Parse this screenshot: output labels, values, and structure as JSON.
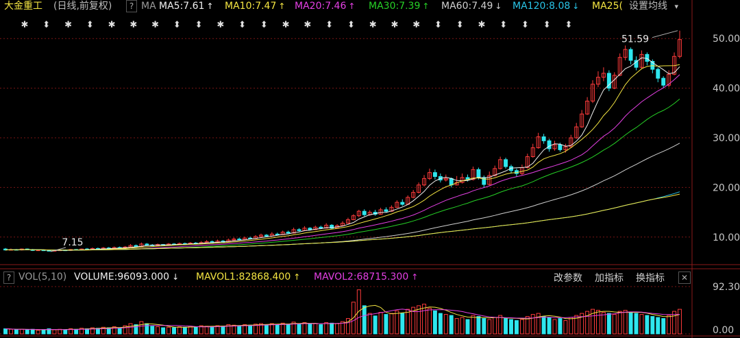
{
  "header": {
    "stock_name": "大金重工",
    "period_label": "(日线,前复权)",
    "help_label": "?",
    "ma_prefix": "MA",
    "ma_items": [
      {
        "label": "MA5:7.61",
        "arrow": "↑",
        "color": "#f0f0f0"
      },
      {
        "label": "MA10:7.47",
        "arrow": "↑",
        "color": "#f5e642"
      },
      {
        "label": "MA20:7.46",
        "arrow": "↑",
        "color": "#e540e5"
      },
      {
        "label": "MA30:7.39",
        "arrow": "↑",
        "color": "#26d126"
      },
      {
        "label": "MA60:7.49",
        "arrow": "↓",
        "color": "#d0d0d0"
      },
      {
        "label": "MA120:8.08",
        "arrow": "↓",
        "color": "#29c5e8"
      },
      {
        "label": "MA25(",
        "arrow": "",
        "color": "#f5e642"
      }
    ],
    "settings_label": "设置均线",
    "settings_arrow": "▾"
  },
  "volume_header": {
    "help_label": "?",
    "indicator_label": "VOL(5,10)",
    "items": [
      {
        "label": "VOLUME:96093.000",
        "arrow": "↓",
        "color": "#f0f0f0"
      },
      {
        "label": "MAVOL1:82868.400",
        "arrow": "↑",
        "color": "#f5e642"
      },
      {
        "label": "MAVOL2:68715.300",
        "arrow": "↑",
        "color": "#e540e5"
      }
    ],
    "buttons": {
      "modify_params": "改参数",
      "add_indicator": "加指标",
      "switch_indicator": "换指标",
      "close": "✕"
    }
  },
  "chart_data": {
    "type": "candlestick",
    "price_axis": {
      "ticks": [
        "50.00",
        "40.00",
        "30.00",
        "20.00",
        "10.00"
      ],
      "range": [
        5,
        55
      ]
    },
    "volume_axis": {
      "ticks": [
        "92.30",
        "0.00"
      ],
      "range": [
        0,
        92.3
      ]
    },
    "annotations": {
      "high_label": "51.59",
      "low_label": "7.15"
    },
    "marker_row": [
      "✱",
      "⬍",
      "✱",
      "⬍",
      "✱",
      "✱",
      "✱",
      "⬍",
      "⬍",
      "✱",
      "⬍",
      "⬍",
      "✱",
      "✱",
      "⬍",
      "⬍",
      "✱",
      "✱",
      "✱",
      "⬍",
      "⬍",
      "✱",
      "⬍",
      "⬍",
      "⬍",
      "⬍"
    ],
    "colors": {
      "up": "#ff3b3b",
      "down": "#2ee6ee",
      "ma5": "#f0f0f0",
      "ma10": "#f5e642",
      "ma20": "#e540e5",
      "ma30": "#26d126",
      "ma60": "#d0d0d0",
      "ma120": "#29c5e8",
      "ma250": "#f5e642"
    },
    "candles": [
      [
        7.6,
        7.4,
        7.8,
        7.3,
        10
      ],
      [
        7.4,
        7.5,
        7.7,
        7.3,
        9
      ],
      [
        7.5,
        7.4,
        7.6,
        7.3,
        8
      ],
      [
        7.4,
        7.6,
        7.7,
        7.3,
        9
      ],
      [
        7.6,
        7.5,
        7.7,
        7.4,
        8
      ],
      [
        7.5,
        7.3,
        7.6,
        7.2,
        9
      ],
      [
        7.3,
        7.4,
        7.5,
        7.2,
        7
      ],
      [
        7.4,
        7.3,
        7.5,
        7.2,
        8
      ],
      [
        7.3,
        7.2,
        7.4,
        7.15,
        10
      ],
      [
        7.2,
        7.3,
        7.4,
        7.1,
        8
      ],
      [
        7.3,
        7.4,
        7.5,
        7.2,
        9
      ],
      [
        7.4,
        7.3,
        7.5,
        7.2,
        8
      ],
      [
        7.3,
        7.5,
        7.6,
        7.2,
        10
      ],
      [
        7.5,
        7.4,
        7.6,
        7.3,
        9
      ],
      [
        7.4,
        7.6,
        7.7,
        7.3,
        11
      ],
      [
        7.6,
        7.5,
        7.8,
        7.4,
        10
      ],
      [
        7.5,
        7.7,
        7.9,
        7.4,
        12
      ],
      [
        7.7,
        7.6,
        7.9,
        7.5,
        11
      ],
      [
        7.6,
        7.8,
        8.0,
        7.5,
        13
      ],
      [
        7.8,
        7.7,
        8.0,
        7.6,
        12
      ],
      [
        7.7,
        7.9,
        8.1,
        7.6,
        14
      ],
      [
        7.9,
        7.8,
        8.1,
        7.7,
        12
      ],
      [
        7.8,
        8.0,
        8.2,
        7.7,
        16
      ],
      [
        8.0,
        8.3,
        8.6,
        7.9,
        20
      ],
      [
        8.3,
        8.1,
        8.5,
        8.0,
        18
      ],
      [
        8.1,
        8.6,
        8.9,
        8.0,
        24
      ],
      [
        8.6,
        8.4,
        8.8,
        8.3,
        20
      ],
      [
        8.4,
        8.3,
        8.6,
        8.2,
        15
      ],
      [
        8.3,
        8.5,
        8.7,
        8.2,
        14
      ],
      [
        8.5,
        8.4,
        8.6,
        8.3,
        12
      ],
      [
        8.4,
        8.6,
        8.8,
        8.3,
        13
      ],
      [
        8.6,
        8.5,
        8.8,
        8.4,
        12
      ],
      [
        8.5,
        8.7,
        8.9,
        8.4,
        14
      ],
      [
        8.7,
        8.6,
        8.9,
        8.5,
        13
      ],
      [
        8.6,
        8.8,
        9.0,
        8.5,
        15
      ],
      [
        8.8,
        8.7,
        9.0,
        8.6,
        14
      ],
      [
        8.7,
        8.9,
        9.2,
        8.6,
        16
      ],
      [
        8.9,
        9.1,
        9.4,
        8.8,
        15
      ],
      [
        9.1,
        8.9,
        9.3,
        8.8,
        14
      ],
      [
        8.9,
        9.2,
        9.5,
        8.8,
        16
      ],
      [
        9.2,
        9.0,
        9.4,
        8.9,
        15
      ],
      [
        9.0,
        9.4,
        9.7,
        8.9,
        18
      ],
      [
        9.4,
        9.6,
        9.9,
        9.3,
        17
      ],
      [
        9.6,
        9.5,
        9.9,
        9.4,
        16
      ],
      [
        9.5,
        9.8,
        10.1,
        9.4,
        18
      ],
      [
        9.8,
        9.7,
        10.1,
        9.6,
        17
      ],
      [
        9.7,
        10.1,
        10.4,
        9.6,
        19
      ],
      [
        10.1,
        10.4,
        10.7,
        10.0,
        20
      ],
      [
        10.4,
        10.2,
        10.6,
        10.1,
        18
      ],
      [
        10.2,
        10.6,
        11.0,
        10.1,
        20
      ],
      [
        10.6,
        10.5,
        10.9,
        10.4,
        18
      ],
      [
        10.5,
        11.0,
        11.3,
        10.4,
        21
      ],
      [
        11.0,
        10.8,
        11.3,
        10.7,
        19
      ],
      [
        10.8,
        11.5,
        11.9,
        10.7,
        23
      ],
      [
        11.5,
        11.3,
        11.8,
        11.1,
        20
      ],
      [
        11.3,
        11.8,
        12.2,
        11.2,
        22
      ],
      [
        11.8,
        11.5,
        12.0,
        11.3,
        19
      ],
      [
        11.5,
        12.0,
        12.3,
        11.4,
        20
      ],
      [
        12.0,
        11.8,
        12.3,
        11.6,
        18
      ],
      [
        11.8,
        12.4,
        12.8,
        11.7,
        22
      ],
      [
        12.4,
        11.8,
        12.6,
        11.6,
        21
      ],
      [
        11.8,
        12.3,
        12.6,
        11.7,
        20
      ],
      [
        12.3,
        12.8,
        13.2,
        12.2,
        24
      ],
      [
        12.8,
        13.5,
        13.9,
        12.7,
        30
      ],
      [
        13.5,
        14.3,
        14.6,
        13.4,
        62
      ],
      [
        14.3,
        15.2,
        15.5,
        14.0,
        86
      ],
      [
        15.2,
        14.5,
        15.6,
        14.2,
        55
      ],
      [
        14.5,
        15.0,
        15.4,
        14.3,
        40
      ],
      [
        15.0,
        14.6,
        15.5,
        14.3,
        35
      ],
      [
        14.6,
        15.5,
        15.9,
        14.5,
        42
      ],
      [
        15.5,
        15.2,
        16.0,
        15.0,
        38
      ],
      [
        15.2,
        16.0,
        16.4,
        15.1,
        40
      ],
      [
        16.0,
        17.0,
        17.4,
        15.9,
        45
      ],
      [
        17.0,
        16.6,
        17.6,
        16.3,
        40
      ],
      [
        16.6,
        18.0,
        18.4,
        16.5,
        48
      ],
      [
        18.0,
        19.0,
        19.5,
        17.8,
        52
      ],
      [
        19.0,
        20.5,
        21.0,
        18.8,
        55
      ],
      [
        20.5,
        21.8,
        22.5,
        20.2,
        58
      ],
      [
        21.8,
        23.0,
        23.8,
        21.5,
        50
      ],
      [
        23.0,
        22.2,
        23.6,
        21.6,
        45
      ],
      [
        22.2,
        21.5,
        22.8,
        21.0,
        40
      ],
      [
        21.5,
        21.8,
        22.6,
        21.2,
        38
      ],
      [
        21.8,
        20.5,
        22.0,
        20.0,
        36
      ],
      [
        20.5,
        21.0,
        22.3,
        20.4,
        30
      ],
      [
        21.0,
        22.0,
        22.8,
        20.8,
        32
      ],
      [
        22.0,
        21.6,
        22.6,
        21.2,
        28
      ],
      [
        21.6,
        23.6,
        24.2,
        21.4,
        36
      ],
      [
        23.6,
        22.0,
        24.0,
        21.6,
        34
      ],
      [
        22.0,
        20.6,
        22.4,
        20.0,
        30
      ],
      [
        20.6,
        22.4,
        23.2,
        20.4,
        28
      ],
      [
        22.4,
        23.8,
        24.4,
        22.2,
        32
      ],
      [
        23.8,
        25.6,
        26.2,
        23.6,
        36
      ],
      [
        25.6,
        24.2,
        26.0,
        23.8,
        30
      ],
      [
        24.2,
        23.4,
        24.6,
        22.8,
        28
      ],
      [
        23.4,
        22.8,
        23.8,
        22.2,
        26
      ],
      [
        22.8,
        24.0,
        24.6,
        22.5,
        28
      ],
      [
        24.0,
        26.2,
        26.8,
        23.8,
        34
      ],
      [
        26.2,
        28.0,
        28.8,
        26.0,
        38
      ],
      [
        28.0,
        30.2,
        31.0,
        27.8,
        40
      ],
      [
        30.2,
        29.4,
        30.8,
        28.8,
        34
      ],
      [
        29.4,
        27.8,
        29.8,
        27.2,
        32
      ],
      [
        27.8,
        28.6,
        29.4,
        27.4,
        28
      ],
      [
        28.6,
        27.6,
        29.0,
        27.2,
        30
      ],
      [
        27.6,
        28.2,
        28.8,
        27.0,
        26
      ],
      [
        28.2,
        30.0,
        30.6,
        28.0,
        32
      ],
      [
        30.0,
        32.2,
        33.0,
        29.8,
        36
      ],
      [
        32.2,
        34.8,
        35.6,
        32.0,
        40
      ],
      [
        34.8,
        37.4,
        38.2,
        34.6,
        44
      ],
      [
        37.4,
        40.8,
        41.6,
        37.0,
        48
      ],
      [
        40.8,
        42.2,
        43.4,
        40.2,
        46
      ],
      [
        42.2,
        43.0,
        44.2,
        41.4,
        42
      ],
      [
        43.0,
        40.0,
        43.6,
        39.4,
        40
      ],
      [
        40.0,
        42.6,
        43.2,
        39.8,
        38
      ],
      [
        42.6,
        46.2,
        47.0,
        42.4,
        44
      ],
      [
        46.2,
        47.8,
        48.6,
        45.6,
        46
      ],
      [
        47.8,
        45.6,
        48.2,
        44.8,
        42
      ],
      [
        45.6,
        44.2,
        46.4,
        43.6,
        40
      ],
      [
        44.2,
        46.8,
        47.6,
        43.8,
        38
      ],
      [
        46.8,
        45.4,
        47.2,
        44.6,
        36
      ],
      [
        45.4,
        43.8,
        45.8,
        43.0,
        34
      ],
      [
        43.8,
        42.0,
        44.2,
        41.2,
        32
      ],
      [
        42.0,
        40.6,
        42.4,
        40.0,
        30
      ],
      [
        40.6,
        42.8,
        43.6,
        40.2,
        36
      ],
      [
        42.8,
        46.4,
        47.2,
        42.6,
        44
      ],
      [
        46.4,
        49.8,
        51.59,
        46.0,
        48
      ]
    ]
  }
}
